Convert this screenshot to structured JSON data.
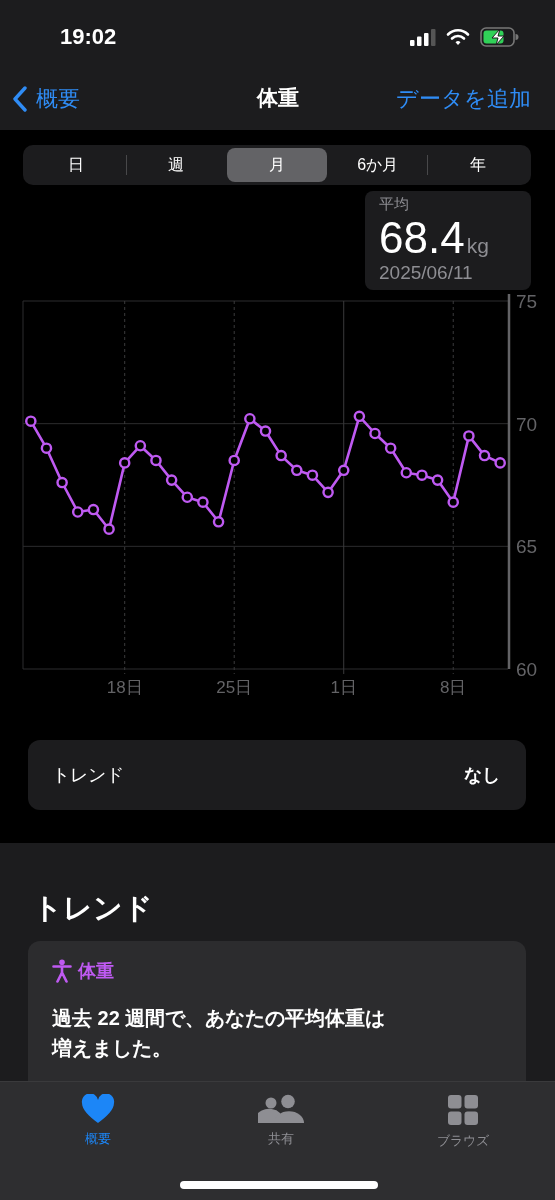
{
  "status_bar": {
    "time": "19:02"
  },
  "nav": {
    "back": "概要",
    "title": "体重",
    "action": "データを追加"
  },
  "segments": [
    {
      "label": "日",
      "selected": false
    },
    {
      "label": "週",
      "selected": false
    },
    {
      "label": "月",
      "selected": true
    },
    {
      "label": "6か月",
      "selected": false
    },
    {
      "label": "年",
      "selected": false
    }
  ],
  "summary": {
    "label": "平均",
    "value": "68.4",
    "unit": "kg",
    "date": "2025/06/11"
  },
  "chart_data": {
    "type": "line",
    "categories": [
      null,
      null,
      null,
      null,
      null,
      null,
      "18日",
      null,
      null,
      null,
      null,
      null,
      null,
      "25日",
      null,
      null,
      null,
      null,
      null,
      null,
      "1日",
      null,
      null,
      null,
      null,
      null,
      null,
      "8日",
      null,
      null,
      null
    ],
    "series": [
      {
        "color": "#bf5af2",
        "marker": "circle",
        "values": [
          70.1,
          69.0,
          67.6,
          66.4,
          66.5,
          65.7,
          68.4,
          69.1,
          68.5,
          67.7,
          67.0,
          66.8,
          66.0,
          68.5,
          70.2,
          69.7,
          68.7,
          68.1,
          67.9,
          67.2,
          68.1,
          70.3,
          69.6,
          69.0,
          68.0,
          67.9,
          67.7,
          66.8,
          69.5,
          68.7,
          68.4
        ]
      }
    ],
    "ylim": [
      60,
      75
    ],
    "grid": true,
    "yticks": [
      60,
      65,
      70,
      75
    ]
  },
  "trend_row": {
    "label": "トレンド",
    "value": "なし"
  },
  "trends_section": {
    "heading": "トレンド",
    "card": {
      "category": "体重",
      "text": "過去 22 週間で、あなたの平均体重は増えました。"
    }
  },
  "tab_bar": [
    {
      "kind": "heart",
      "label": "概要",
      "selected": true
    },
    {
      "kind": "people",
      "label": "共有",
      "selected": false
    },
    {
      "kind": "grid",
      "label": "ブラウズ",
      "selected": false
    }
  ]
}
